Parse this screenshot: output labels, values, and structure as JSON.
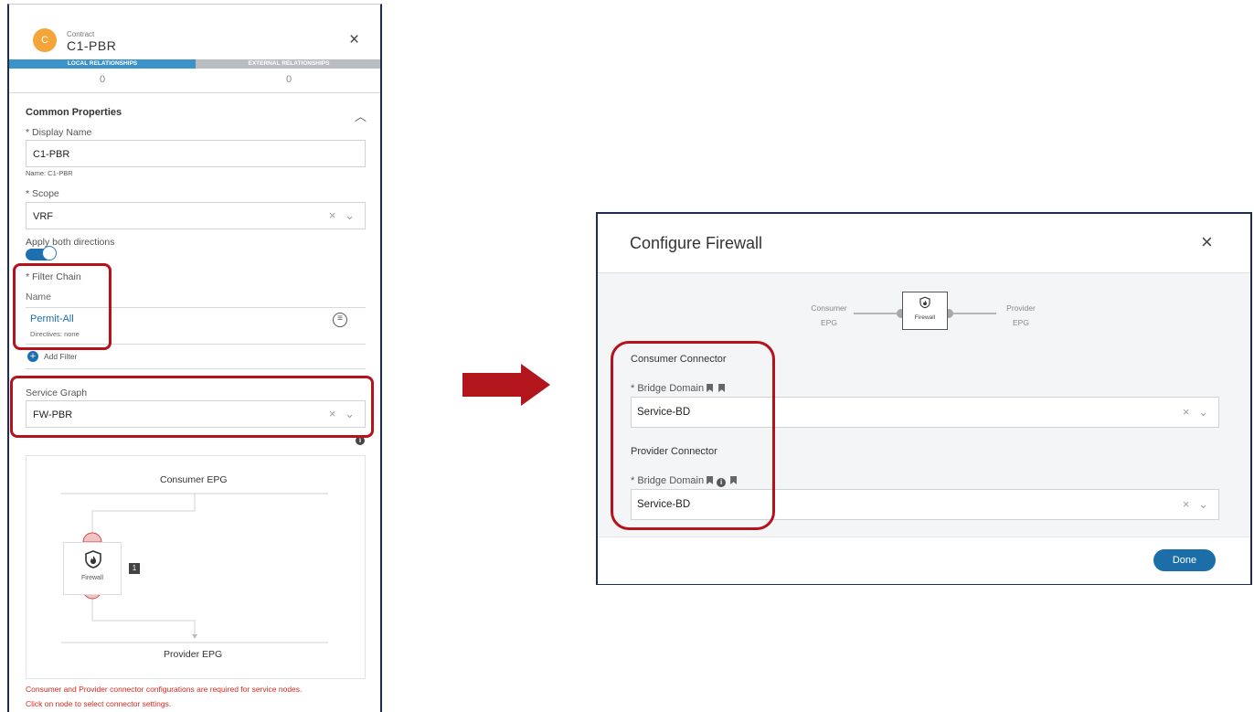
{
  "contract_panel": {
    "avatar_letter": "C",
    "type_label": "Contract",
    "title": "C1-PBR",
    "close_icon": "×",
    "tabs": [
      {
        "label": "LOCAL RELATIONSHIPS",
        "count": "0"
      },
      {
        "label": "EXTERNAL RELATIONSHIPS",
        "count": "0"
      }
    ],
    "section_title": "Common Properties",
    "display_name": {
      "label": "* Display Name",
      "value": "C1-PBR",
      "hint": "Name: C1-PBR"
    },
    "scope": {
      "label": "* Scope",
      "value": "VRF",
      "controls": "× ⌄"
    },
    "apply_both": {
      "label": "Apply both directions",
      "enabled": true
    },
    "filter_chain": {
      "label": "* Filter Chain",
      "column": "Name",
      "filter_name": "Permit-All",
      "directives": "Directives: none",
      "add_label": "Add Filter"
    },
    "service_graph": {
      "label": "Service Graph",
      "value": "FW-PBR",
      "controls": "× ⌄"
    },
    "graph": {
      "consumer": "Consumer EPG",
      "provider": "Provider EPG",
      "node_label": "Firewall",
      "node_badge": "1"
    },
    "error_lines": [
      "Consumer and Provider connector configurations are required for service nodes.",
      "Click on node to select connector settings."
    ]
  },
  "modal": {
    "title": "Configure Firewall",
    "close_icon": "×",
    "diagram": {
      "consumer_line1": "Consumer",
      "consumer_line2": "EPG",
      "node_label": "Firewall",
      "provider_line1": "Provider",
      "provider_line2": "EPG"
    },
    "consumer_connector": {
      "heading": "Consumer Connector",
      "field_label": "* Bridge Domain",
      "value": "Service-BD",
      "controls": "× ⌄"
    },
    "provider_connector": {
      "heading": "Provider Connector",
      "field_label": "* Bridge Domain",
      "value": "Service-BD",
      "controls": "× ⌄"
    },
    "done_label": "Done"
  },
  "colors": {
    "highlight": "#b5121b",
    "accent_blue": "#1d6fb0",
    "error_red": "#d8281e",
    "avatar": "#f4a539"
  },
  "icons": {
    "firewall": "firewall-shield-icon",
    "arrow": "right-arrow-icon",
    "bookmark": "bookmark-icon",
    "info": "info-icon"
  }
}
